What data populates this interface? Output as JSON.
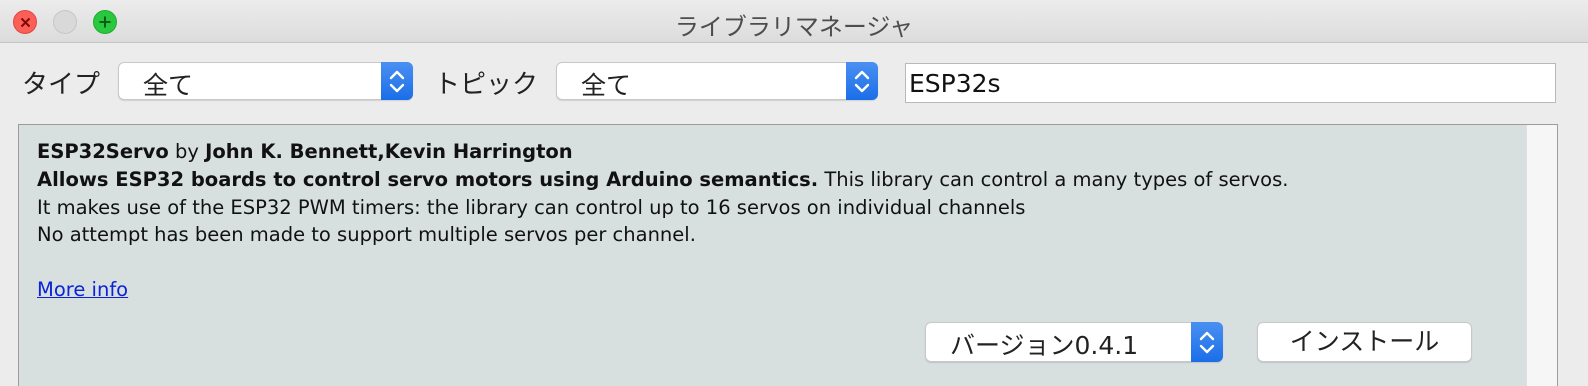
{
  "window": {
    "title": "ライブラリマネージャ"
  },
  "filters": {
    "type_label": "タイプ",
    "type_value": "全て",
    "topic_label": "トピック",
    "topic_value": "全て",
    "search_value": "ESP32s"
  },
  "library": {
    "name": "ESP32Servo",
    "by_text": " by ",
    "authors": "John K. Bennett,Kevin Harrington",
    "summary": "Allows ESP32 boards to control servo motors using Arduino semantics.",
    "summary_tail": " This library can control a many types of servos.",
    "line2": "It makes use of the ESP32 PWM timers: the library can control up to 16 servos on individual channels",
    "line3": "No attempt has been made to support multiple servos per channel.",
    "more_info": "More info",
    "version_label": "バージョン0.4.1",
    "install_label": "インストール"
  },
  "icons": {
    "close": "close-icon",
    "minimize": "minimize-icon",
    "zoom": "zoom-plus-icon",
    "select_arrows": "chevron-updown-icon"
  },
  "colors": {
    "accent": "#1b6ee8",
    "link": "#0b22d8",
    "list_background": "#d7e0df",
    "close": "#fc5f57",
    "zoom": "#29c840"
  }
}
